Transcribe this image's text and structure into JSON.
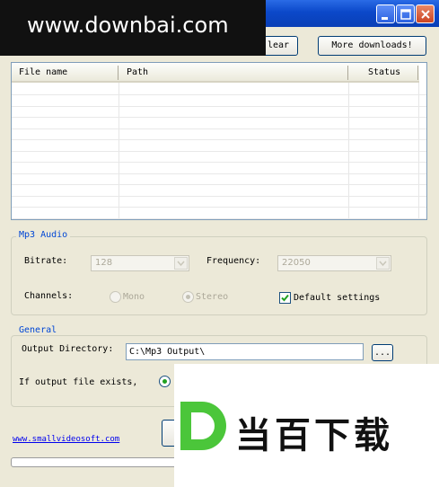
{
  "window": {
    "watermark_text": "www.downbai.com"
  },
  "toolbar": {
    "clear_label": "lear",
    "more_downloads_label": "More downloads!"
  },
  "file_list": {
    "columns": [
      "File name",
      "Path",
      "Status"
    ],
    "rows": []
  },
  "mp3_audio": {
    "legend": "Mp3 Audio",
    "bitrate_label": "Bitrate:",
    "bitrate_value": "128",
    "frequency_label": "Frequency:",
    "frequency_value": "22050",
    "channels_label": "Channels:",
    "mono_label": "Mono",
    "stereo_label": "Stereo",
    "stereo_selected": true,
    "default_settings_label": "Default settings",
    "default_settings_checked": true
  },
  "general": {
    "legend": "General",
    "output_dir_label": "Output Directory:",
    "output_dir_value": "C:\\Mp3 Output\\",
    "browse_label": "...",
    "exists_label": "If output file exists,"
  },
  "footer": {
    "website_link": "www.smallvideosoft.com",
    "progress": 0
  },
  "overlay": {
    "brand_letter": "D",
    "brand_text": "当百下载"
  },
  "colors": {
    "titlebar": "#0b48c9",
    "accent_legend": "#0046d5",
    "link": "#0000ee",
    "brand_green": "#4bc63a"
  }
}
